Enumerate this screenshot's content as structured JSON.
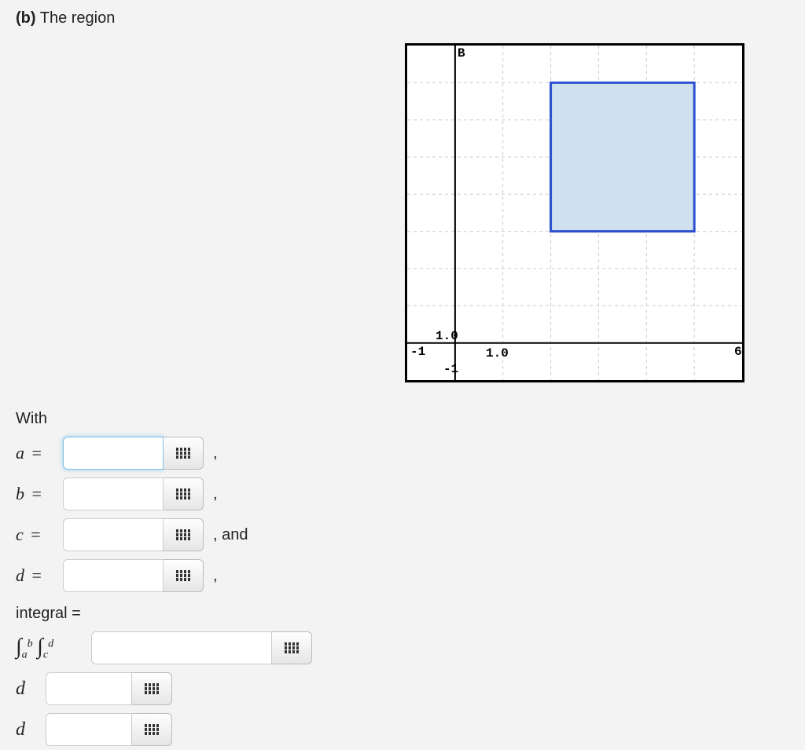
{
  "heading_part": "(b)",
  "heading_text": "The region",
  "with_label": "With",
  "rows": {
    "a": {
      "label": "a",
      "value": "",
      "tail": ","
    },
    "b": {
      "label": "b",
      "value": "",
      "tail": ","
    },
    "c": {
      "label": "c",
      "value": "",
      "tail": ", and"
    },
    "d": {
      "label": "d",
      "value": "",
      "tail": ","
    }
  },
  "integral_label": "integral =",
  "integral_symbol_html": "∫ b a  ∫ d c",
  "integral_value": "",
  "d_rows": [
    {
      "label": "d",
      "value": ""
    },
    {
      "label": "d",
      "value": ""
    }
  ],
  "chart_data": {
    "type": "area",
    "title": "",
    "xlabel": "",
    "ylabel": "",
    "x_range": [
      -1,
      6
    ],
    "y_range": [
      -1,
      8
    ],
    "x_ticks": [
      -1,
      1.0
    ],
    "y_ticks": [
      -1,
      1.0
    ],
    "y_axis_label_top": "B",
    "grid": true,
    "region": {
      "x0": 2,
      "x1": 5,
      "y0": 3,
      "y1": 7
    }
  }
}
